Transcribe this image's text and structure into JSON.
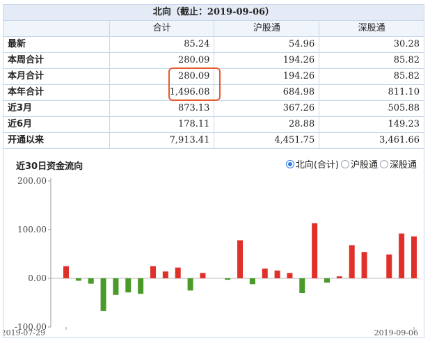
{
  "table": {
    "title": "北向（截止：2019-09-06）",
    "headers": [
      "",
      "合计",
      "沪股通",
      "深股通"
    ],
    "rows": [
      {
        "label": "最新",
        "values": [
          "85.24",
          "54.96",
          "30.28"
        ]
      },
      {
        "label": "本周合计",
        "values": [
          "280.09",
          "194.26",
          "85.82"
        ]
      },
      {
        "label": "本月合计",
        "values": [
          "280.09",
          "194.26",
          "85.82"
        ]
      },
      {
        "label": "本年合计",
        "values": [
          "1,496.08",
          "684.98",
          "811.10"
        ]
      },
      {
        "label": "近3月",
        "values": [
          "873.13",
          "367.26",
          "505.88"
        ]
      },
      {
        "label": "近6月",
        "values": [
          "178.11",
          "28.88",
          "149.23"
        ]
      },
      {
        "label": "开通以来",
        "values": [
          "7,913.41",
          "4,451.75",
          "3,461.66"
        ]
      }
    ]
  },
  "chart_panel": {
    "title": "近30日资金流向",
    "radios": [
      {
        "label": "北向(合计)",
        "checked": true
      },
      {
        "label": "沪股通",
        "checked": false
      },
      {
        "label": "深股通",
        "checked": false
      }
    ]
  },
  "colors": {
    "positive": "#e0302a",
    "negative": "#4a9a2a",
    "highlight": "#e55a33"
  },
  "chart_data": {
    "type": "bar",
    "title": "",
    "ylim": [
      -100,
      200
    ],
    "yticks": [
      "-100.00",
      "0.00",
      "100.00",
      "200.00"
    ],
    "x_start_label": "2019-07-29",
    "x_end_label": "2019-09-06",
    "values": [
      25,
      -5,
      -11,
      -67,
      -34,
      -29,
      -32,
      25,
      14,
      22,
      -25,
      11,
      0,
      -3,
      78,
      -12,
      20,
      16,
      11,
      -30,
      113,
      -9,
      4,
      68,
      54,
      0,
      49,
      92,
      86
    ]
  }
}
